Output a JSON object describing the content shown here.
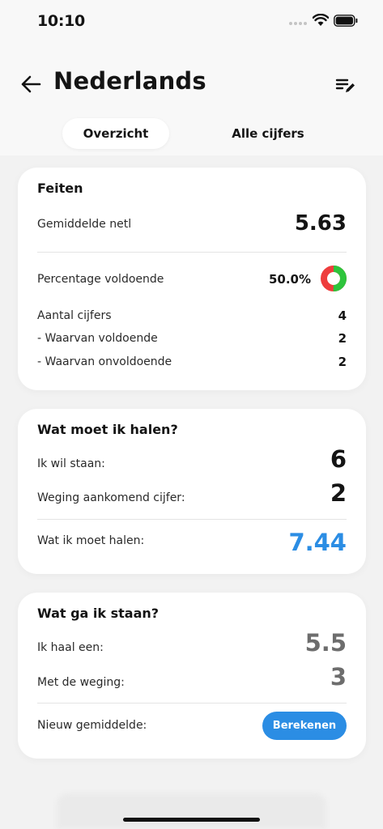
{
  "status_bar": {
    "time": "10:10"
  },
  "header": {
    "title": "Nederlands"
  },
  "tabs": [
    {
      "label": "Overzicht",
      "active": true
    },
    {
      "label": "Alle cijfers",
      "active": false
    }
  ],
  "facts": {
    "title": "Feiten",
    "average_label": "Gemiddelde netl",
    "average_value": "5.63",
    "percentage_label": "Percentage voldoende",
    "percentage_value": "50.0%",
    "percentage_fraction": 0.5,
    "count_label": "Aantal cijfers",
    "count_value": "4",
    "sufficient_label": "- Waarvan voldoende",
    "sufficient_value": "2",
    "insufficient_label": "- Waarvan onvoldoende",
    "insufficient_value": "2"
  },
  "need": {
    "title": "Wat moet ik halen?",
    "target_label": "Ik wil staan:",
    "target_value": "6",
    "weight_label": "Weging aankomend cijfer:",
    "weight_value": "2",
    "result_label": "Wat ik moet halen:",
    "result_value": "7.44"
  },
  "predict": {
    "title": "Wat ga ik staan?",
    "grade_label": "Ik haal een:",
    "grade_placeholder": "5.5",
    "weight_label": "Met de weging:",
    "weight_placeholder": "3",
    "new_avg_label": "Nieuw gemiddelde:",
    "calculate_label": "Berekenen"
  },
  "colors": {
    "accent": "#2b8de4",
    "sufficient": "#2ec43c",
    "insufficient": "#ee3d3d"
  }
}
